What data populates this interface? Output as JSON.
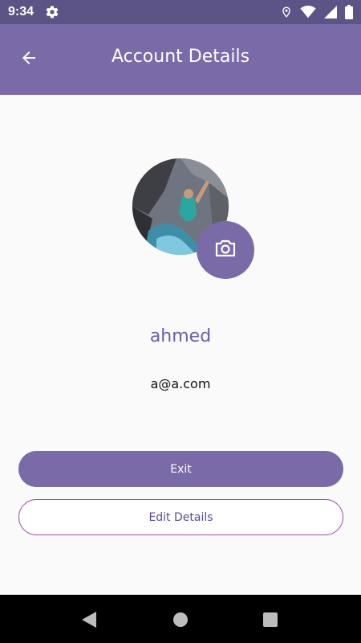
{
  "status_bar": {
    "time": "9:34",
    "icons": [
      "gear-icon",
      "location-icon",
      "wifi-icon",
      "signal-icon",
      "battery-icon"
    ]
  },
  "app_bar": {
    "title": "Account Details",
    "back_icon": "arrow-left-icon"
  },
  "profile": {
    "name": "ahmed",
    "email": "a@a.com",
    "photo": "avatar-photo",
    "change_photo_icon": "camera-icon"
  },
  "actions": {
    "exit_label": "Exit",
    "edit_label": "Edit Details"
  },
  "nav_bar": {
    "icons": [
      "back-triangle-icon",
      "home-circle-icon",
      "recents-square-icon"
    ]
  },
  "colors": {
    "status_bar": "#5c5487",
    "app_bar": "#7a6aa8",
    "accent": "#7a6aa8",
    "name_text": "#6f5ea6",
    "edit_border": "#9b4fa5"
  }
}
